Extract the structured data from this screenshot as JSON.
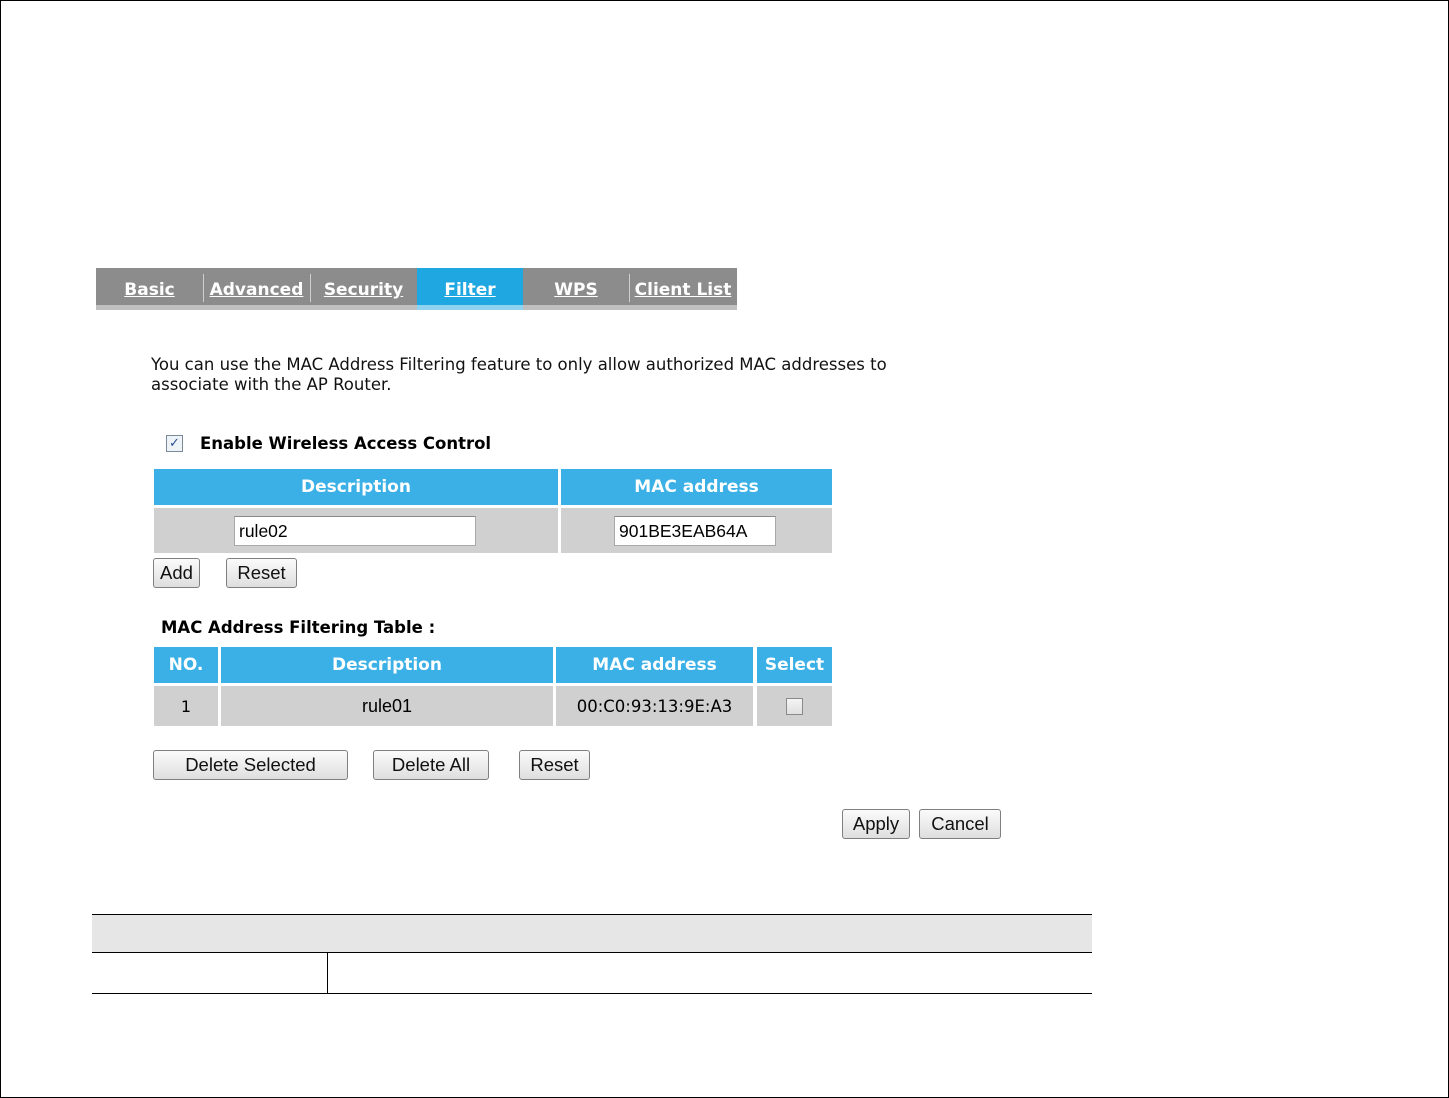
{
  "tabs": [
    {
      "label": "Basic"
    },
    {
      "label": "Advanced"
    },
    {
      "label": "Security"
    },
    {
      "label": "Filter",
      "active": true
    },
    {
      "label": "WPS"
    },
    {
      "label": "Client List"
    }
  ],
  "intro_text": "You can use the MAC Address Filtering feature to only allow authorized MAC addresses to associate with the AP Router.",
  "enable": {
    "label": "Enable Wireless Access Control",
    "checked": true
  },
  "entry_table": {
    "headers": {
      "description": "Description",
      "mac": "MAC address"
    },
    "description_value": "rule02",
    "mac_value": "901BE3EAB64A"
  },
  "entry_buttons": {
    "add": "Add",
    "reset": "Reset"
  },
  "filter_table": {
    "title": "MAC Address Filtering Table :",
    "headers": {
      "no": "NO.",
      "description": "Description",
      "mac": "MAC address",
      "select": "Select"
    },
    "rows": [
      {
        "no": "1",
        "description": "rule01",
        "mac": "00:C0:93:13:9E:A3",
        "selected": false
      }
    ]
  },
  "table_buttons": {
    "delete_selected": "Delete Selected",
    "delete_all": "Delete All",
    "reset": "Reset"
  },
  "footer_buttons": {
    "apply": "Apply",
    "cancel": "Cancel"
  },
  "colors": {
    "tab_bar": "#8c8c8c",
    "tab_active": "#1ea7e0",
    "table_header": "#3ab0e6",
    "table_body": "#d0d0d0"
  }
}
